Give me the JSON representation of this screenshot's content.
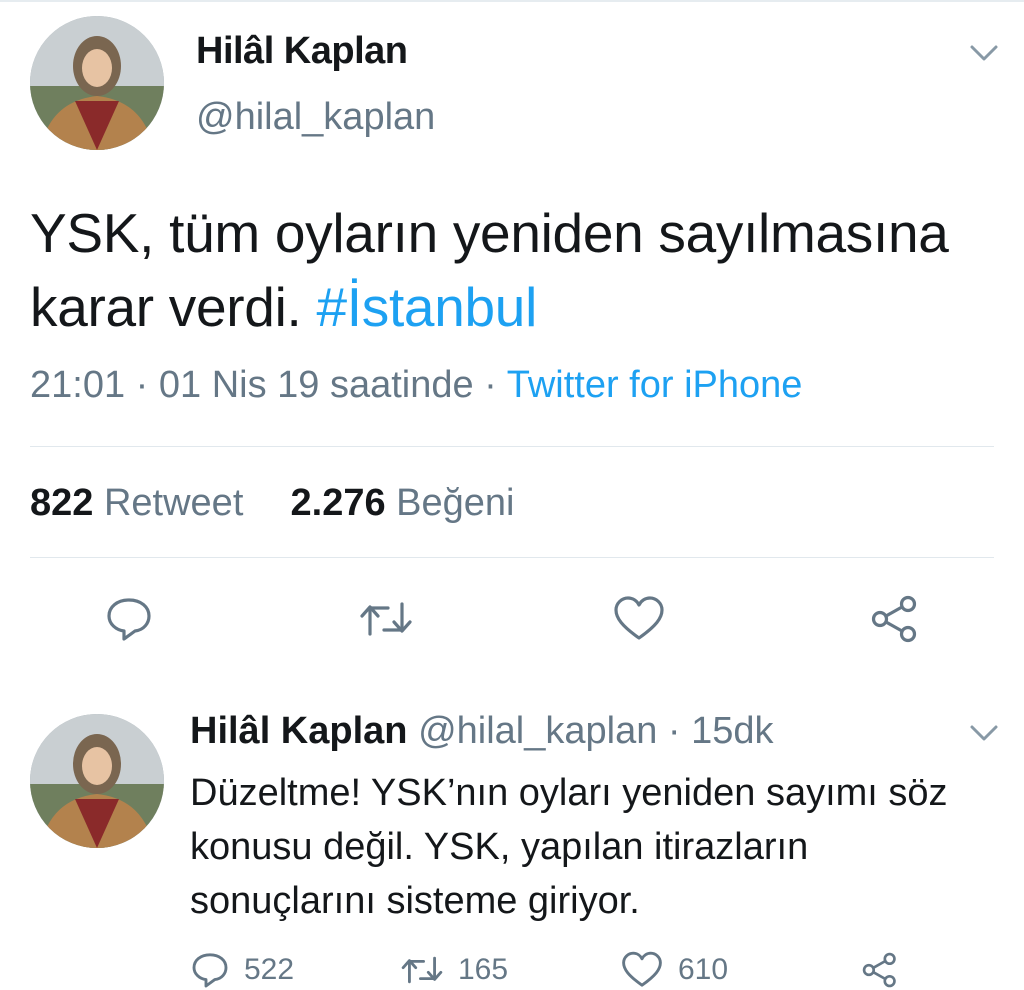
{
  "main_tweet": {
    "author_name": "Hilâl Kaplan",
    "author_handle": "@hilal_kaplan",
    "text_main": "YSK, tüm oyların yeniden sayılmasına karar verdi.",
    "hashtag": "#İstanbul",
    "meta_time": "21:01 · 01 Nis 19 saatinde · ",
    "meta_source": "Twitter for iPhone",
    "retweet_count": "822",
    "retweet_label": "Retweet",
    "like_count": "2.276",
    "like_label": "Beğeni"
  },
  "reply_tweet": {
    "author_name": "Hilâl Kaplan",
    "author_handle": "@hilal_kaplan",
    "separator": "·",
    "time_ago": "15dk",
    "text": "Düzeltme! YSK’nın oyları yeniden sayımı söz konusu değil. YSK, yapılan itirazların sonuçlarını sisteme giriyor.",
    "reply_count": "522",
    "retweet_count": "165",
    "like_count": "610"
  },
  "icons": {
    "reply": "reply-icon",
    "retweet": "retweet-icon",
    "like": "heart-icon",
    "share": "share-icon",
    "menu": "chevron-down-icon"
  },
  "colors": {
    "link": "#1da1f2",
    "secondary_text": "#657786",
    "primary_text": "#14171a",
    "divider": "#e1e8ed"
  }
}
